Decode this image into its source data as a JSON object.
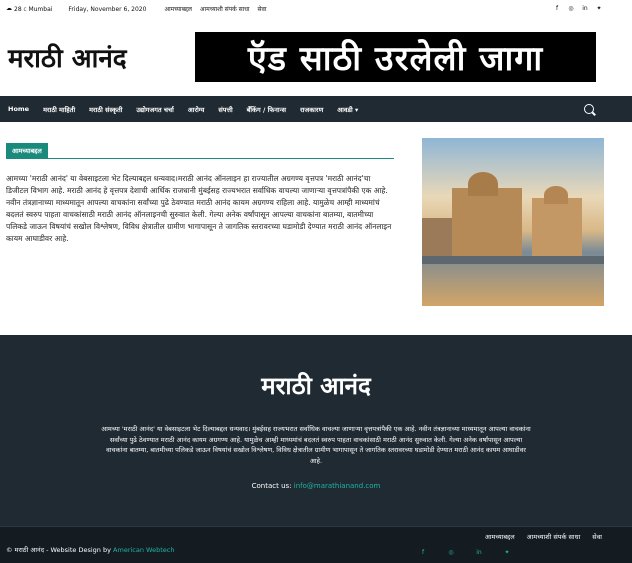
{
  "topbar": {
    "weather_temp": "28",
    "weather_unit": "C",
    "city": "Mumbai",
    "date": "Friday, November 6, 2020",
    "links": [
      "आमच्याबद्दल",
      "आमच्याशी संपर्क साधा",
      "सेवा"
    ],
    "social_icons": [
      "facebook-icon",
      "instagram-icon",
      "linkedin-icon",
      "twitter-icon"
    ]
  },
  "header": {
    "logo": "मराठी आनंद",
    "ad_text": "ऍड साठी उरलेली जागा"
  },
  "nav": {
    "items": [
      "Home",
      "मराठी माहिती",
      "मराठी संस्कृती",
      "उद्योगजगत चर्चा",
      "आरोग्य",
      "संपत्ती",
      "बँकिंग / फिनान्स",
      "राजकारण",
      "आवडी"
    ]
  },
  "main": {
    "section_title": "आमच्याबद्दल",
    "about_text": "आमच्या 'मराठी आनंद' या वेबसाइटला भेट दिल्याबद्दल धन्यवाद।मराठी आनंद ऑनलाइन हा राज्यातील अग्रगण्य वृत्तपत्र 'मराठी आनंद'चा डिजीटल विभाग आहे. मराठी आनंद हे वृत्तपत्र देशाची आर्थिक राजधानी मुंबईसह राज्यभरात सर्वाधिक वाचल्या जाणाऱ्या वृत्तपत्रांपैकी एक आहे. नवीन तंत्रज्ञानाच्या माध्यमातून आपल्या वाचकांना सर्वांच्या पुढे ठेवण्यात मराठी आनंद कायम अग्रगण्य राहिला आहे. यामुळेच आम्ही माध्यमांचं बदलतं स्वरुप पाहता वाचकांसाठी मराठी आनंद ऑनलाइनची सुरुवात केली. गेल्या अनेक वर्षांपासून आपल्या वाचकांना बातम्या, बातमीच्या पलिकडे जाऊन विषयांचं सखोल विश्लेषण, विविध क्षेत्रातील ग्रामीण भागापासून ते जागतिक स्तरावरच्या घडामोडी देण्यात मराठी आनंद ऑनलाइन कायम आघाडीवर आहे."
  },
  "footer": {
    "logo": "मराठी आनंद",
    "description": "आमच्या 'मराठी आनंद' या वेबसाइटला भेट दिल्याबद्दल धन्यवाद। मुंबईसह राज्यभरात सर्वाधिक वाचल्या जाणाऱ्या वृत्तपत्रांपैकी एक आहे. नवीन तंत्रज्ञानाच्या माध्यमातून आपल्या वाचकांना सर्वांच्या पुढे ठेवण्यात मराठी आनंद कायम अग्रगण्य आहे. यामुळेच आम्ही माध्यमांचं बदलतं स्वरुप पाहता वाचकांसाठी मराठी आनंद सुरुवात केली. गेल्या अनेक वर्षांपासून आपल्या वाचकांना बातम्या, बातमीच्या पलिकडे जाऊन विषयांचं सखोल विश्लेषण, विविध क्षेत्रातील ग्रामीण भागापासून ते जागतिक स्तरावरच्या घडामोडी देण्यात मराठी आनंद कायम आघाडीवर आहे.",
    "contact_label": "Contact us:",
    "contact_email": "info@marathianand.com"
  },
  "bottombar": {
    "copyright": "© मराठी आनंद - Website Design by",
    "designer": "American Webtech",
    "links": [
      "आमच्याबद्दल",
      "आमच्याशी संपर्क साधा",
      "सेवा"
    ],
    "social_icons": [
      "facebook-icon",
      "instagram-icon",
      "linkedin-icon",
      "twitter-icon"
    ],
    "accent_color": "#1fb5a0"
  }
}
